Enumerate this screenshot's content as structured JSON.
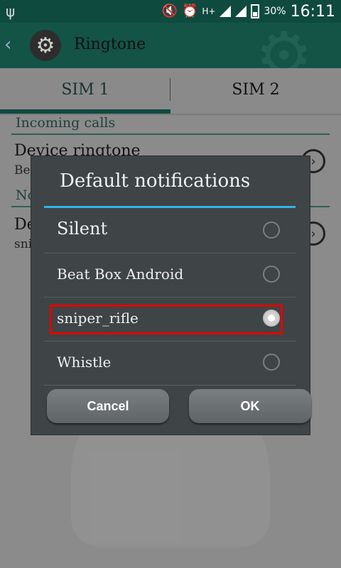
{
  "status_bar": {
    "icons": [
      "usb-icon",
      "mute-icon",
      "alarm-icon",
      "h-plus-icon",
      "signal-icon",
      "signal-icon",
      "battery-icon"
    ],
    "network_type": "H+",
    "battery_percent": "30%",
    "time": "16:11"
  },
  "action_bar": {
    "title": "Ringtone",
    "icon": "settings-gear-icon"
  },
  "tabs": [
    {
      "label": "SIM 1",
      "selected": true
    },
    {
      "label": "SIM 2",
      "selected": false
    }
  ],
  "background_list": {
    "section_1": "Incoming calls",
    "item_1_title": "Device ringtone",
    "item_1_sub": "Bea",
    "section_2": "No",
    "item_2_title": "De",
    "item_2_sub": "sni"
  },
  "dialog": {
    "title": "Default notifications",
    "options": [
      {
        "label": "Silent",
        "selected": false
      },
      {
        "label": "Beat Box Android",
        "selected": false
      },
      {
        "label": "sniper_rifle",
        "selected": true
      },
      {
        "label": "Whistle",
        "selected": false
      }
    ],
    "cancel_label": "Cancel",
    "ok_label": "OK",
    "accent_color": "#33b5e5",
    "highlight_color": "#e00000"
  }
}
